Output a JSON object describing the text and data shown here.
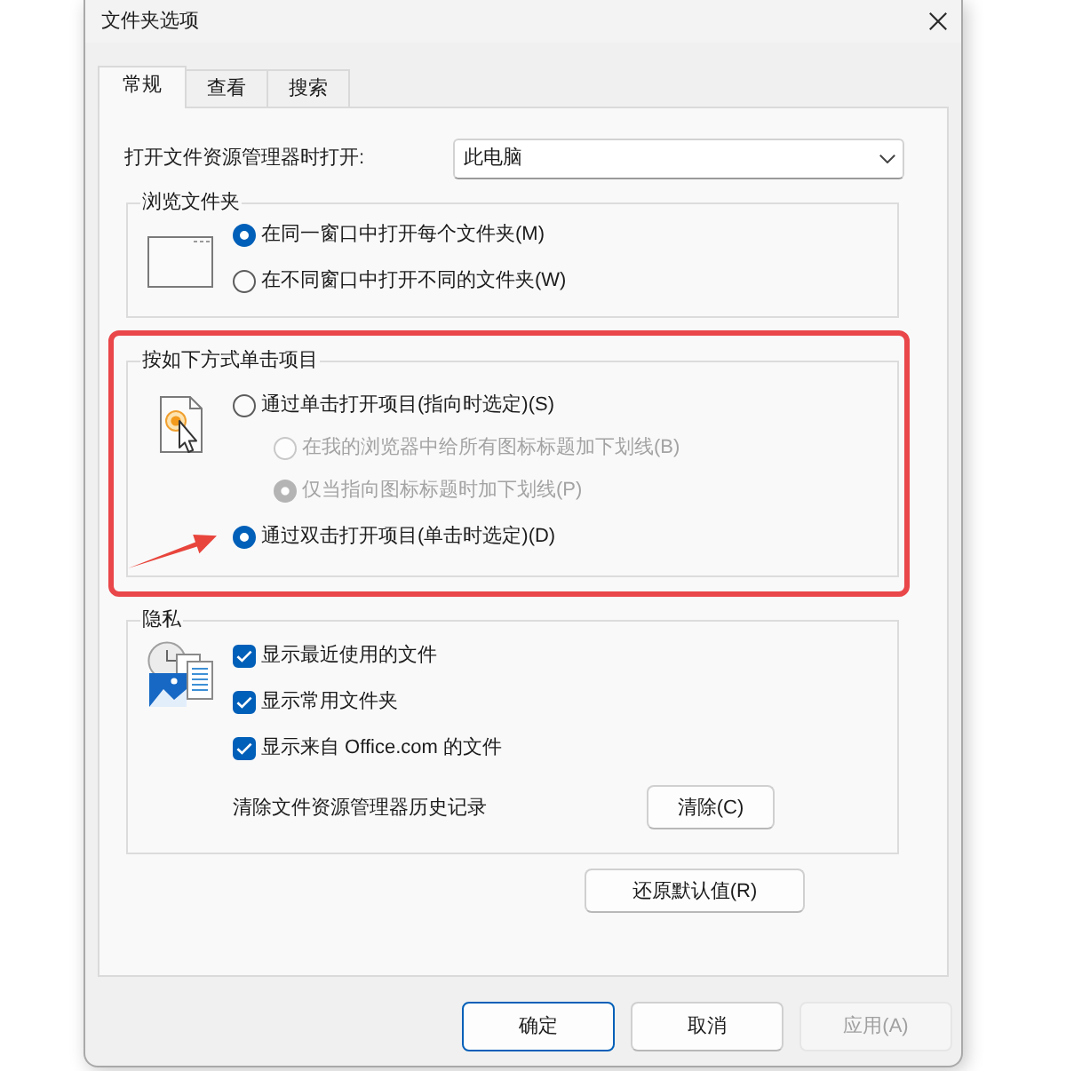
{
  "window": {
    "title": "文件夹选项"
  },
  "tabs": [
    {
      "label": "常规",
      "selected": true
    },
    {
      "label": "查看",
      "selected": false
    },
    {
      "label": "搜索",
      "selected": false
    }
  ],
  "open_in": {
    "label": "打开文件资源管理器时打开:",
    "value": "此电脑"
  },
  "browse_folders": {
    "title": "浏览文件夹",
    "options": [
      {
        "label": "在同一窗口中打开每个文件夹(M)",
        "selected": true,
        "disabled": false
      },
      {
        "label": "在不同窗口中打开不同的文件夹(W)",
        "selected": false,
        "disabled": false
      }
    ]
  },
  "click_items": {
    "title": "按如下方式单击项目",
    "highlighted": true,
    "options": [
      {
        "label": "通过单击打开项目(指向时选定)(S)",
        "selected": false,
        "disabled": false,
        "arrow": false,
        "children": [
          {
            "label": "在我的浏览器中给所有图标标题加下划线(B)",
            "selected": false,
            "disabled": true
          },
          {
            "label": "仅当指向图标标题时加下划线(P)",
            "selected": true,
            "disabled": true
          }
        ]
      },
      {
        "label": "通过双击打开项目(单击时选定)(D)",
        "selected": true,
        "disabled": false,
        "arrow": true
      }
    ]
  },
  "privacy": {
    "title": "隐私",
    "checkboxes": [
      {
        "label": "显示最近使用的文件",
        "checked": true
      },
      {
        "label": "显示常用文件夹",
        "checked": true
      },
      {
        "label": "显示来自 Office.com 的文件",
        "checked": true
      }
    ],
    "clear_label": "清除文件资源管理器历史记录",
    "clear_button": "清除(C)"
  },
  "restore_button": "还原默认值(R)",
  "buttons": [
    {
      "label": "确定",
      "default": true,
      "disabled": false
    },
    {
      "label": "取消",
      "default": false,
      "disabled": false
    },
    {
      "label": "应用(A)",
      "default": false,
      "disabled": true
    }
  ]
}
